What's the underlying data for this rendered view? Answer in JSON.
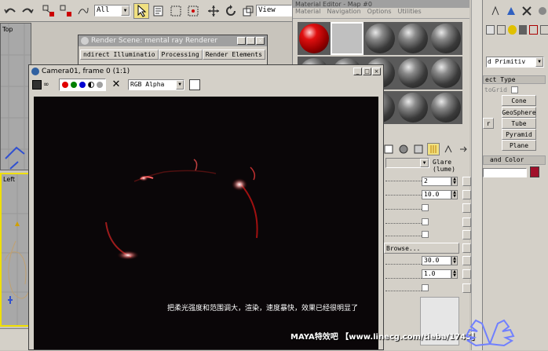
{
  "toolbar": {
    "filter_value": "All",
    "view_value": "View"
  },
  "viewports": {
    "top_label": "Top",
    "left_label": "Left"
  },
  "material_editor": {
    "title": "Material Editor - Map #0",
    "menu": [
      "Material",
      "Navigation",
      "Options",
      "Utilities"
    ],
    "map_dropdown": "Glare (lume)",
    "params": [
      {
        "value": "2"
      },
      {
        "value": "10.0"
      }
    ],
    "browse_label": "Browse...",
    "params2": [
      {
        "value": "30.0"
      },
      {
        "value": "1.0"
      }
    ]
  },
  "command_panel": {
    "dropdown": "d Primitiv",
    "rollout_title": "ect Type",
    "autogrid": "toGrid",
    "buttons": [
      "Cone",
      "GeoSphere",
      "Tube",
      "Pyramid",
      "Plane"
    ],
    "partial_button": "r",
    "name_color": "and Color",
    "swatch_color": "#a0102a"
  },
  "render_scene": {
    "title": "Render Scene: mental ray Renderer",
    "tabs": [
      "ndirect Illuminatio",
      "Processing",
      "Render Elements"
    ]
  },
  "frame_window": {
    "title": "Camera01, frame 0 (1:1)",
    "channel_dropdown": "RGB Alpha",
    "channel_colors": {
      "red": "#e00000",
      "green": "#008000",
      "blue": "#0000d0"
    },
    "caption": "把柔光强度和范围调大，渲染，速度暴快，效果已经很明显了"
  },
  "watermark": {
    "text": "MAYA特效吧 【www.linecg.com/tieba/1745】"
  }
}
